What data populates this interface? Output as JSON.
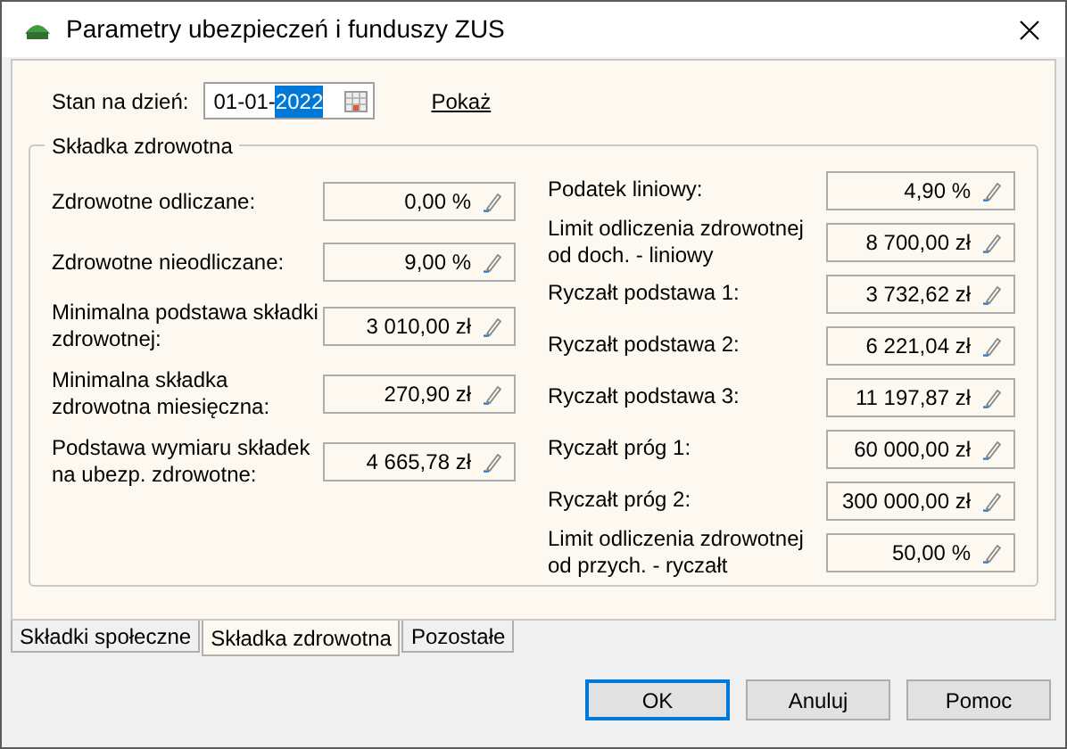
{
  "window": {
    "title": "Parametry ubezpieczeń i funduszy ZUS"
  },
  "date_row": {
    "label": "Stan na dzień:",
    "value_parts": [
      {
        "text": "01-01-",
        "selected": false
      },
      {
        "text": "2022",
        "selected": true
      }
    ],
    "link": "Pokaż"
  },
  "group": {
    "title": "Składka zdrowotna",
    "left": [
      {
        "label": "Zdrowotne odliczane:",
        "value": "0,00 %"
      },
      {
        "label": "Zdrowotne nieodliczane:",
        "value": "9,00 %"
      },
      {
        "label": "Minimalna podstawa składki zdrowotnej:",
        "value": "3 010,00 zł"
      },
      {
        "label": "Minimalna składka zdrowotna miesięczna:",
        "value": "270,90 zł"
      },
      {
        "label": "Podstawa wymiaru składek na ubezp. zdrowotne:",
        "value": "4 665,78 zł"
      }
    ],
    "right": [
      {
        "label": "Podatek liniowy:",
        "value": "4,90 %"
      },
      {
        "label": "Limit odliczenia zdrowotnej od doch. - liniowy",
        "value": "8 700,00 zł"
      },
      {
        "label": "Ryczałt podstawa 1:",
        "value": "3 732,62 zł"
      },
      {
        "label": "Ryczałt podstawa 2:",
        "value": "6 221,04 zł"
      },
      {
        "label": "Ryczałt podstawa 3:",
        "value": "11 197,87 zł"
      },
      {
        "label": "Ryczałt próg 1:",
        "value": "60 000,00 zł"
      },
      {
        "label": "Ryczałt próg 2:",
        "value": "300 000,00 zł"
      },
      {
        "label": "Limit odliczenia zdrowotnej od przych. - ryczałt",
        "value": "50,00 %"
      }
    ]
  },
  "tabs": [
    {
      "label": "Składki społeczne",
      "selected": false
    },
    {
      "label": "Składka zdrowotna",
      "selected": true
    },
    {
      "label": "Pozostałe",
      "selected": false
    }
  ],
  "buttons": [
    {
      "label": "OK",
      "default": true
    },
    {
      "label": "Anuluj",
      "default": false
    },
    {
      "label": "Pomoc",
      "default": false
    }
  ]
}
